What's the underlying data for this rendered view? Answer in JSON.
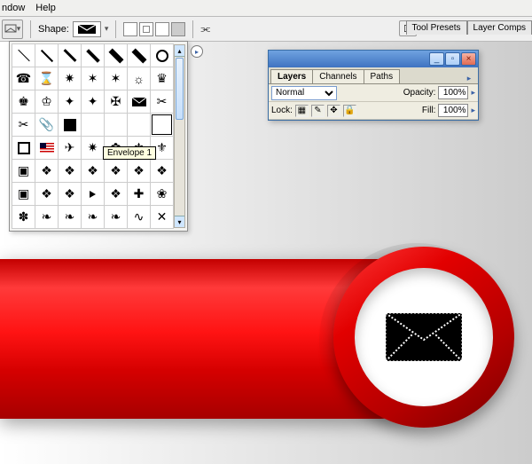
{
  "menu": {
    "window": "ndow",
    "help": "Help"
  },
  "optbar": {
    "shape_label": "Shape:",
    "selected_shape": "envelope"
  },
  "right_tabs": {
    "tool_presets": "Tool Presets",
    "layer_comps": "Layer Comps"
  },
  "shapes": {
    "tooltip": "Envelope 1",
    "selected_index": 27,
    "rows": [
      [
        "line-thin",
        "line",
        "line-med",
        "line-thick",
        "line-xthick",
        "line-xthick",
        "circle-o"
      ],
      [
        "phone",
        "hourglass",
        "bat-star",
        "star-thin",
        "star-6",
        "sunburst",
        "crown-q"
      ],
      [
        "crown-k",
        "crown-ch",
        "star-sym",
        "star-sym2",
        "star-cross",
        "envelope",
        "scissors"
      ],
      [
        "scissors-open",
        "clip",
        "blackbox",
        "",
        "",
        "",
        ""
      ],
      [
        "square-o",
        "flag",
        "plane",
        "starburst",
        "flower",
        "fleur",
        "fleur2"
      ],
      [
        "sq-orn",
        "tile1",
        "tile2",
        "tile3",
        "tile4",
        "tile5",
        "tile6"
      ],
      [
        "sq-orn2",
        "tile7",
        "tile8",
        "tri-r",
        "tile9",
        "cross-sq",
        "clover"
      ],
      [
        "asterisk",
        "leaf1",
        "leaf2",
        "leaf3",
        "leaf4",
        "swirl",
        "shape-x"
      ]
    ]
  },
  "layers": {
    "tabs": {
      "layers": "Layers",
      "channels": "Channels",
      "paths": "Paths"
    },
    "blend_label": "Normal",
    "opacity_label": "Opacity:",
    "opacity_value": "100%",
    "lock_label": "Lock:",
    "fill_label": "Fill:",
    "fill_value": "100%",
    "lock_icons": [
      "transparent",
      "pixels",
      "position",
      "all"
    ]
  }
}
